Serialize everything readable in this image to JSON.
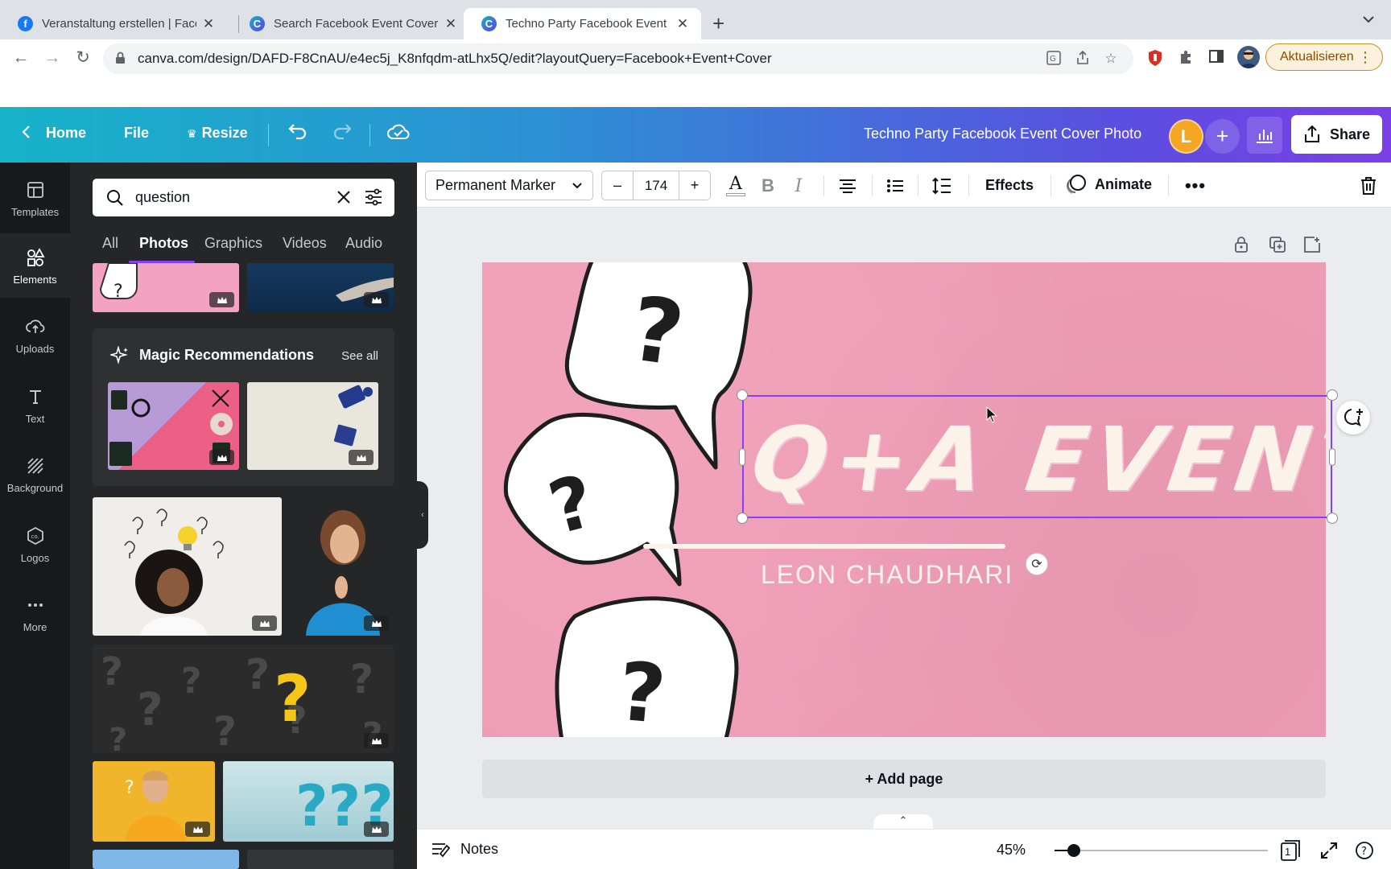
{
  "browser": {
    "tabs": [
      {
        "label": "Veranstaltung erstellen | Faceb",
        "icon": "facebook-icon"
      },
      {
        "label": "Search Facebook Event Cover",
        "icon": "canva-icon"
      },
      {
        "label": "Techno Party Facebook Event C",
        "icon": "canva-icon"
      }
    ],
    "url": "canva.com/design/DAFD-F8CnAU/e4ec5j_K8nfqdm-atLhx5Q/edit?layoutQuery=Facebook+Event+Cover",
    "update_label": "Aktualisieren"
  },
  "header": {
    "home": "Home",
    "file": "File",
    "resize": "Resize",
    "doc_title": "Techno Party Facebook Event Cover Photo",
    "avatar_initial": "L",
    "share": "Share",
    "gradient_start": "#17b3c9",
    "gradient_end": "#7a3fe6"
  },
  "rail": {
    "items": [
      {
        "label": "Templates",
        "icon": "templates-icon"
      },
      {
        "label": "Elements",
        "icon": "elements-icon"
      },
      {
        "label": "Uploads",
        "icon": "uploads-icon"
      },
      {
        "label": "Text",
        "icon": "text-icon"
      },
      {
        "label": "Background",
        "icon": "background-icon"
      },
      {
        "label": "Logos",
        "icon": "logos-icon"
      },
      {
        "label": "More",
        "icon": "more-icon"
      }
    ],
    "active": "Elements"
  },
  "panel": {
    "search_value": "question",
    "tabs": [
      "All",
      "Photos",
      "Graphics",
      "Videos",
      "Audio"
    ],
    "active_tab": "Photos",
    "magic_title": "Magic Recommendations",
    "see_all": "See all"
  },
  "toolbar": {
    "font": "Permanent Marker",
    "minus": "–",
    "font_size": "174",
    "plus": "+",
    "effects": "Effects",
    "animate": "Animate"
  },
  "canvas": {
    "headline": "Q+A EVENT",
    "author": "LEON CHAUDHARI",
    "background_color": "#ef9cb6",
    "selection_color": "#8b3dff"
  },
  "footer": {
    "add_page": "+ Add page",
    "notes": "Notes",
    "zoom": "45%",
    "page_count": "1"
  }
}
